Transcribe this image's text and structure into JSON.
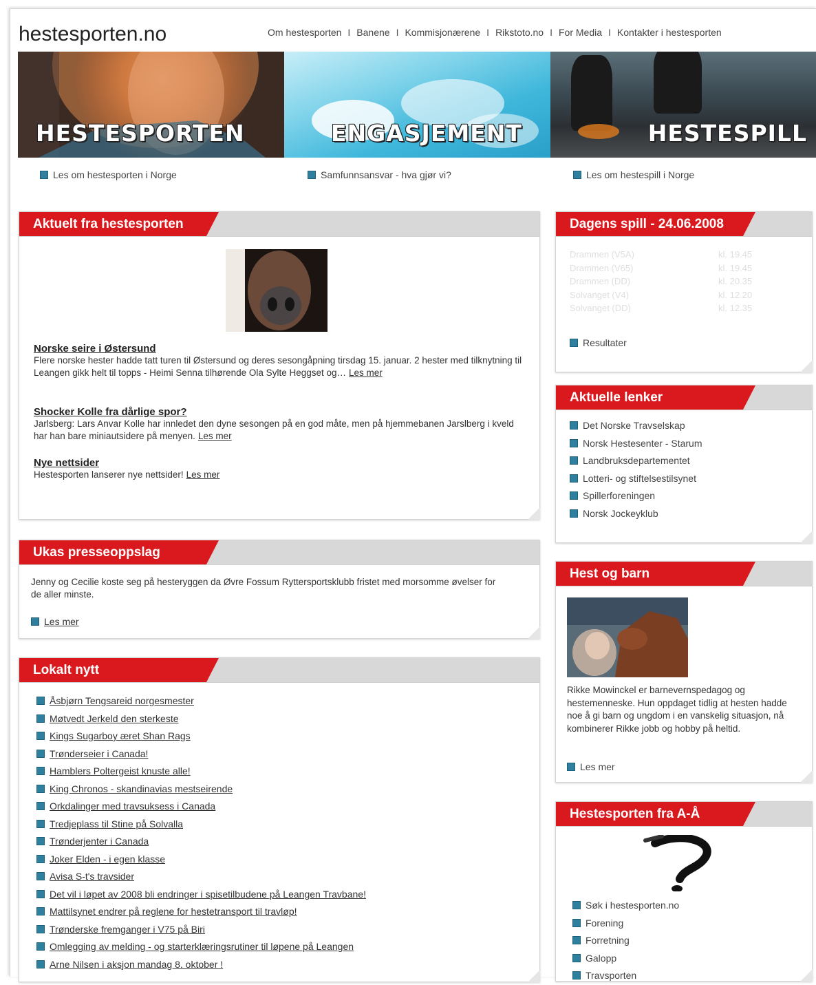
{
  "header": {
    "logo": "hestesporten.no",
    "nav": [
      "Om hestesporten",
      "Banene",
      "Kommisjonærene",
      "Rikstoto.no",
      "For Media",
      "Kontakter i hestesporten"
    ],
    "separator": "I"
  },
  "banners": [
    {
      "title": "HESTESPORTEN",
      "link": "Les om hestesporten i Norge"
    },
    {
      "title": "ENGASJEMENT",
      "link": "Samfunnsansvar - hva gjør vi?"
    },
    {
      "title": "HESTESPILL",
      "link": "Les om hestespill i Norge"
    }
  ],
  "aktuelt": {
    "heading": "Aktuelt fra hestesporten",
    "items": [
      {
        "title": "Norske seire i Østersund",
        "text": "Flere norske hester hadde tatt turen til Østersund og deres sesongåpning tirsdag 15. januar. 2 hester med tilknytning til Leangen gikk helt til topps - Heimi Senna tilhørende Ola Sylte Heggset og…",
        "more": "Les mer"
      },
      {
        "title": "Shocker Kolle fra dårlige spor?",
        "text": "Jarlsberg: Lars Anvar Kolle har innledet den dyne sesongen på en god måte, men på hjemmebanen Jarslberg i kveld har han bare miniautsidere på menyen.",
        "more": "Les mer"
      },
      {
        "title": "Nye nettsider",
        "text": "Hestesporten lanserer nye nettsider!",
        "more": "Les mer"
      }
    ]
  },
  "presse": {
    "heading": "Ukas presseoppslag",
    "text": "Jenny og Cecilie koste seg på hesteryggen da Øvre Fossum Ryttersportsklubb fristet med morsomme øvelser for de aller minste.",
    "more": "Les mer"
  },
  "lokalt": {
    "heading": "Lokalt nytt",
    "items": [
      "Åsbjørn Tengsareid norgesmester",
      "Møtvedt Jerkeld den sterkeste",
      "Kings Sugarboy æret Shan Rags",
      "Trønderseier i Canada!",
      "Hamblers Poltergeist knuste alle!",
      "King Chronos - skandinavias mestseirende",
      "Orkdalinger med travsuksess i Canada",
      "Tredjeplass til Stine på Solvalla",
      "Trønderjenter i Canada",
      "Joker Elden - i egen klasse",
      "Avisa S-t's travsider",
      "Det vil i løpet av 2008 bli endringer i spisetilbudene på Leangen Travbane!",
      "Mattilsynet endrer på reglene for hestetransport til travløp!",
      "Trønderske fremganger i V75 på Biri",
      "Omlegging av melding - og starterklæringsrutiner til løpene på Leangen",
      "Arne Nilsen i aksjon mandag 8. oktober !"
    ]
  },
  "dagens": {
    "heading": "Dagens spill - 24.06.2008",
    "games": [
      {
        "name": "Drammen (V5A)",
        "time": "kl. 19.45"
      },
      {
        "name": "Drammen (V65)",
        "time": "kl. 19.45"
      },
      {
        "name": "Drammen (DD)",
        "time": "kl. 20.35"
      },
      {
        "name": "Solvanget (V4)",
        "time": "kl. 12.20"
      },
      {
        "name": "Solvanget (DD)",
        "time": "kl. 12.35"
      }
    ],
    "link": "Resultater"
  },
  "lenker": {
    "heading": "Aktuelle lenker",
    "items": [
      "Det Norske Travselskap",
      "Norsk Hestesenter - Starum",
      "Landbruksdepartementet",
      "Lotteri- og stiftelsestilsynet",
      "Spillerforeningen",
      "Norsk Jockeyklub"
    ]
  },
  "hestbarn": {
    "heading": "Hest og barn",
    "text": "Rikke Mowinckel er barnevernspedagog og hestemenneske. Hun oppdaget tidlig at hesten hadde noe å gi barn og ungdom i en vanskelig situasjon, nå kombinerer Rikke jobb og hobby på heltid.",
    "more": "Les mer"
  },
  "aa": {
    "heading": "Hestesporten fra A-Å",
    "items": [
      "Søk i hestesporten.no",
      "Forening",
      "Forretning",
      "Galopp",
      "Travsporten"
    ]
  },
  "colors": {
    "accent": "#d9191e",
    "bullet": "#2f7f9f",
    "tabgray": "#d8d8d8"
  }
}
